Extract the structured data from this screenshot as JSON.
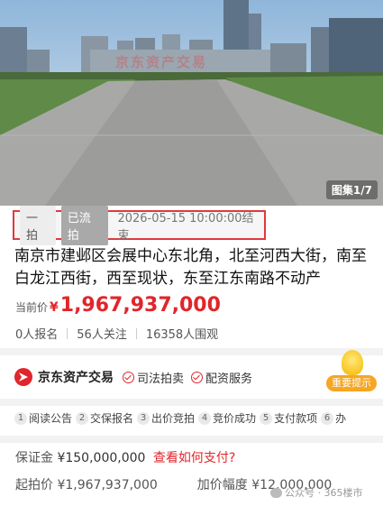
{
  "hero": {
    "gallery_counter": "图集1/7",
    "watermark": "京东资产交易"
  },
  "status": {
    "round": "一拍",
    "state": "已流拍",
    "end_time": "2026-05-15 10:00:00结束"
  },
  "title": "南京市建邺区会展中心东北角，北至河西大街，南至白龙江西街，西至现状，东至江东南路不动产",
  "price": {
    "label": "当前价",
    "currency": "¥",
    "value": "1,967,937,000"
  },
  "stats": [
    "0人报名",
    "56人关注",
    "16358人围观"
  ],
  "brand": {
    "name": "京东资产交易",
    "tags": [
      "司法拍卖",
      "配资服务"
    ],
    "tip_label": "重要提示"
  },
  "steps": [
    {
      "num": "1",
      "label": "阅读公告"
    },
    {
      "num": "2",
      "label": "交保报名"
    },
    {
      "num": "3",
      "label": "出价竞拍"
    },
    {
      "num": "4",
      "label": "竞价成功"
    },
    {
      "num": "5",
      "label": "支付款项"
    },
    {
      "num": "6",
      "label": "办"
    }
  ],
  "deposit": {
    "label": "保证金",
    "value": "¥150,000,000",
    "link": "查看如何支付?"
  },
  "start_price": {
    "label": "起拍价",
    "value": "¥1,967,937,000"
  },
  "increment": {
    "label": "加价幅度",
    "value": "¥12,000,000"
  },
  "credit": "公众号 · 365楼市",
  "colors": {
    "accent": "#e0262b",
    "highlight_border": "#e0393e",
    "tip": "#f5a623"
  }
}
